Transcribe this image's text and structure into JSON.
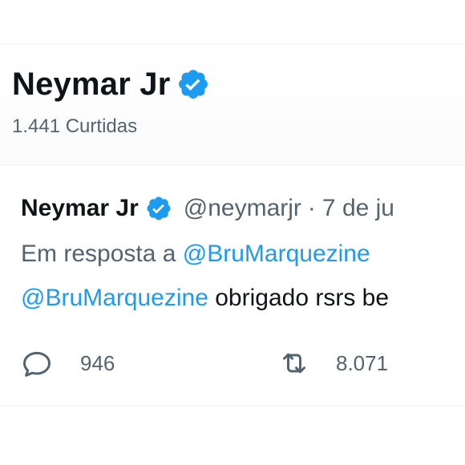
{
  "header": {
    "name": "Neymar Jr",
    "likes": "1.441 Curtidas",
    "verified_icon": "verified-badge-icon"
  },
  "tweet": {
    "name": "Neymar Jr",
    "verified_icon": "verified-badge-icon",
    "handle": "@neymarjr",
    "separator": "·",
    "date": "7 de ju",
    "reply_prefix": "Em resposta a",
    "reply_mention": "@BruMarquezine",
    "body_mention": "@BruMarquezine",
    "body_text": "obrigado rsrs be",
    "actions": {
      "reply_icon": "reply-icon",
      "reply_count": "946",
      "retweet_icon": "retweet-icon",
      "retweet_count": "8.071"
    }
  },
  "colors": {
    "accent": "#1d9bf0",
    "text_primary": "#0f1419",
    "text_secondary": "#536471",
    "divider": "#eff3f4"
  }
}
